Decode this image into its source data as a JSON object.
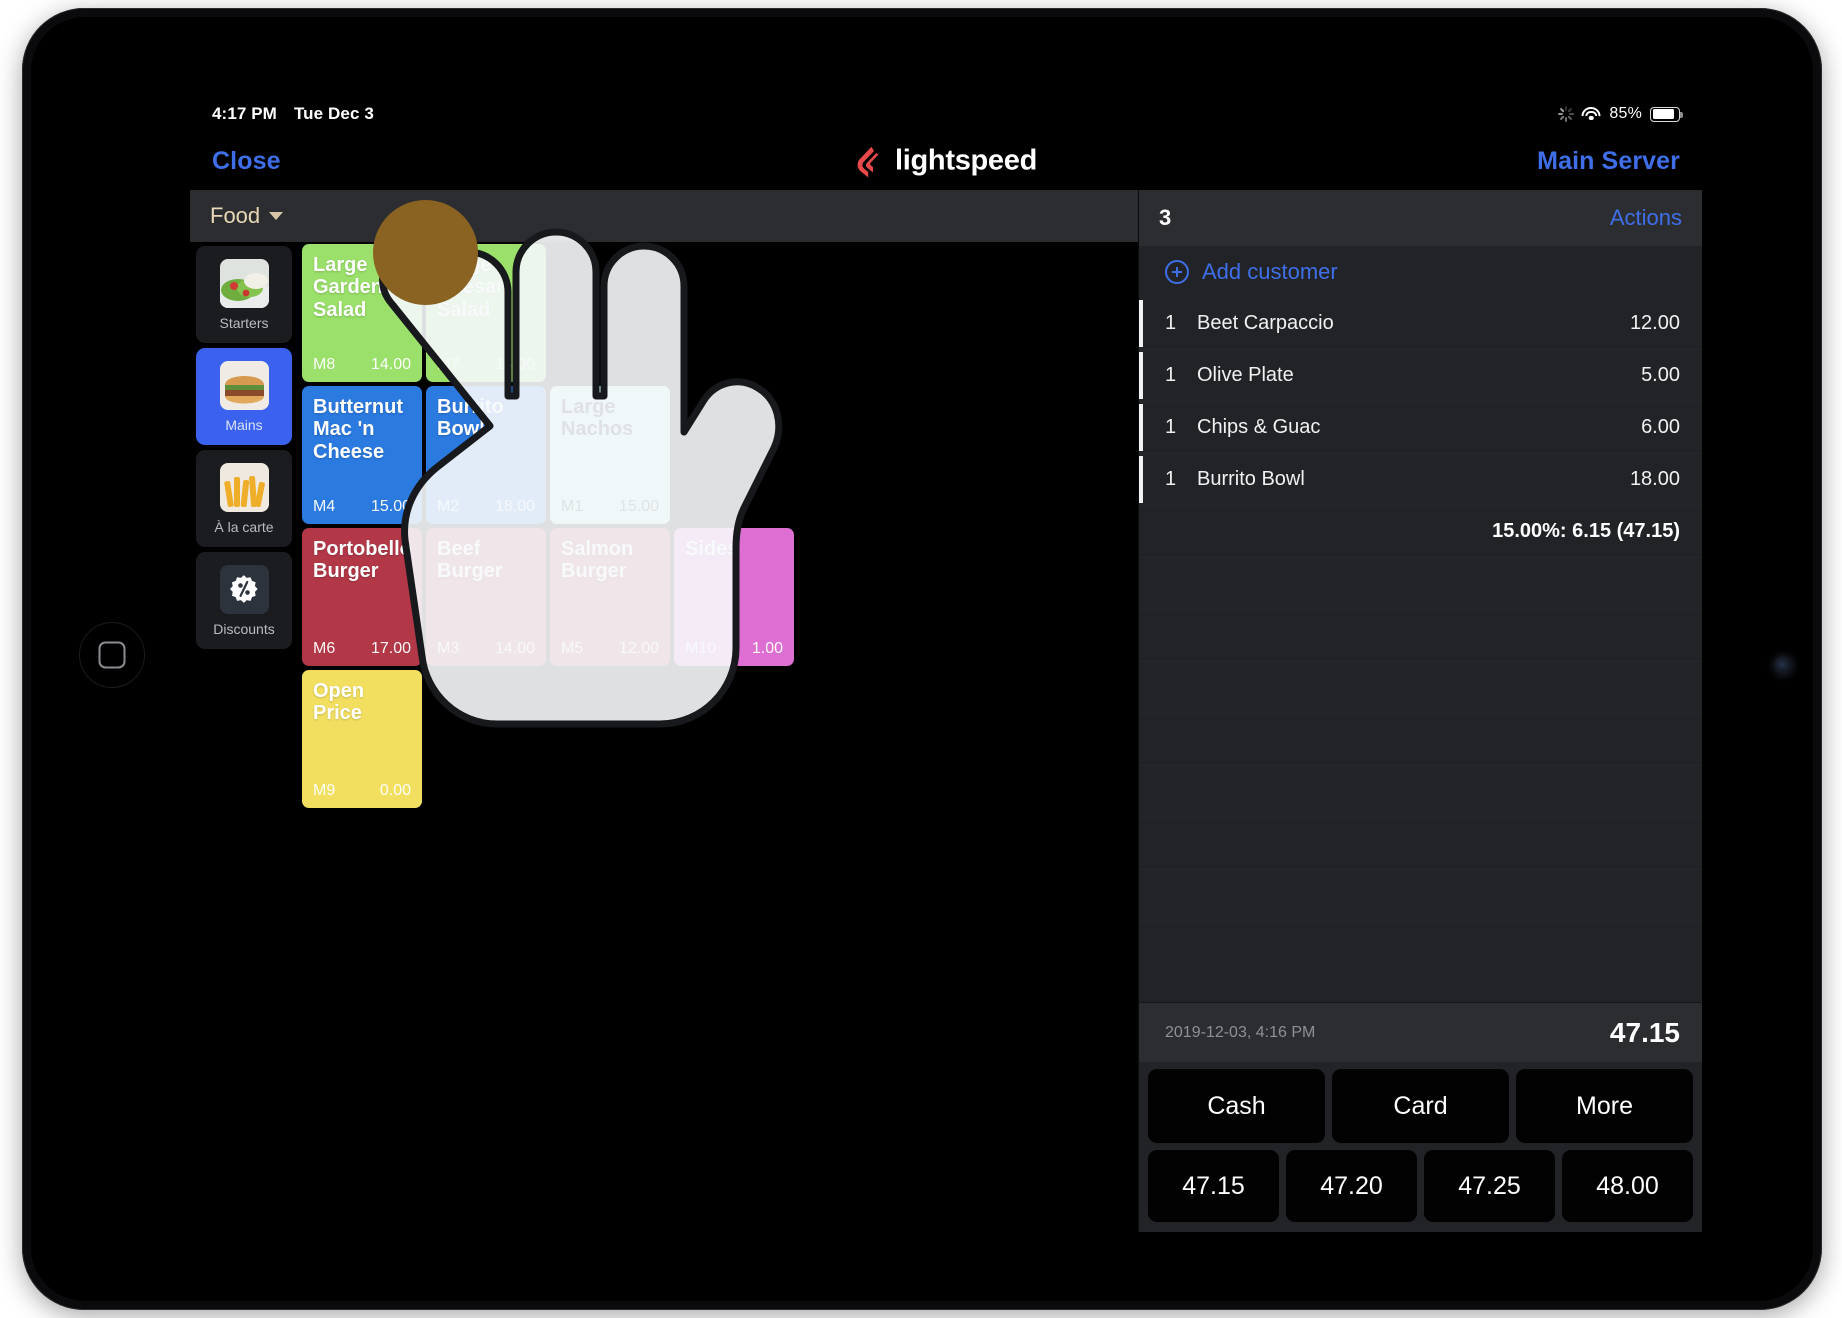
{
  "statusbar": {
    "time": "4:17 PM",
    "date": "Tue Dec 3",
    "battery_percent": "85%",
    "icons": [
      "spinner-icon",
      "wifi-icon",
      "battery-icon"
    ]
  },
  "header": {
    "close_label": "Close",
    "brand_name": "lightspeed",
    "brand_color": "#e8494a",
    "server_label": "Main Server"
  },
  "menu": {
    "dropdown_label": "Food",
    "categories": [
      {
        "label": "Starters",
        "icon": "salad-thumb",
        "selected": false
      },
      {
        "label": "Mains",
        "icon": "burger-thumb",
        "selected": true
      },
      {
        "label": "À la carte",
        "icon": "fries-thumb",
        "selected": false
      },
      {
        "label": "Discounts",
        "icon": "discount-badge-icon",
        "selected": false
      }
    ],
    "products": [
      {
        "name": "Large Garden Salad",
        "code": "M8",
        "price": "14.00",
        "color": "#9ae06a",
        "text": "light",
        "col": 0,
        "row": 0
      },
      {
        "name": "Large Caesar Salad",
        "code": "M7",
        "price": "14.00",
        "color": "#9ae06a",
        "text": "light",
        "col": 1,
        "row": 0
      },
      {
        "name": "Butternut Mac 'n Cheese",
        "code": "M4",
        "price": "15.00",
        "color": "#2b7ae0",
        "text": "light",
        "col": 0,
        "row": 1
      },
      {
        "name": "Burrito Bowl",
        "code": "M2",
        "price": "18.00",
        "color": "#2b7ae0",
        "text": "light",
        "col": 1,
        "row": 1
      },
      {
        "name": "Large Nachos",
        "code": "M1",
        "price": "15.00",
        "color": "#b4eae8",
        "text": "dark",
        "col": 2,
        "row": 1
      },
      {
        "name": "Portobello Burger",
        "code": "M6",
        "price": "17.00",
        "color": "#b23848",
        "text": "light",
        "col": 0,
        "row": 2
      },
      {
        "name": "Beef Burger",
        "code": "M3",
        "price": "14.00",
        "color": "#b23848",
        "text": "light",
        "col": 1,
        "row": 2
      },
      {
        "name": "Salmon Burger",
        "code": "M5",
        "price": "12.00",
        "color": "#b23848",
        "text": "light",
        "col": 2,
        "row": 2
      },
      {
        "name": "Sides",
        "code": "M10",
        "price": "1.00",
        "color": "#dd6ed2",
        "text": "light",
        "col": 3,
        "row": 2
      },
      {
        "name": "Open Price",
        "code": "M9",
        "price": "0.00",
        "color": "#f2df60",
        "text": "light",
        "col": 0,
        "row": 3
      }
    ]
  },
  "order": {
    "count": "3",
    "actions_label": "Actions",
    "add_customer_label": "Add customer",
    "items": [
      {
        "qty": "1",
        "name": "Beet Carpaccio",
        "amount": "12.00"
      },
      {
        "qty": "1",
        "name": "Olive Plate",
        "amount": "5.00"
      },
      {
        "qty": "1",
        "name": "Chips & Guac",
        "amount": "6.00"
      },
      {
        "qty": "1",
        "name": "Burrito Bowl",
        "amount": "18.00"
      }
    ],
    "tip_line": "15.00%: 6.15 (47.15)",
    "timestamp": "2019-12-03, 4:16 PM",
    "total": "47.15",
    "payment_buttons": [
      "Cash",
      "Card",
      "More"
    ],
    "quick_amounts": [
      "47.15",
      "47.20",
      "47.25",
      "48.00"
    ]
  },
  "overlay": {
    "gesture": "tap-hand",
    "target": "food-dropdown",
    "tap_color": "#8a6222"
  }
}
